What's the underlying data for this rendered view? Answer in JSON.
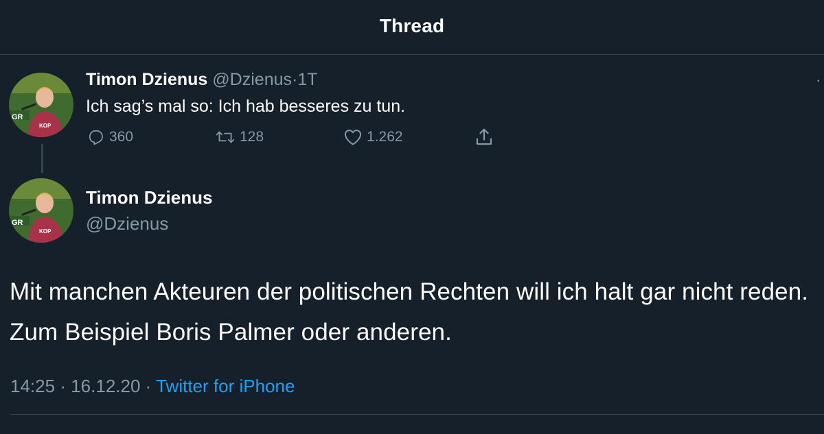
{
  "header": {
    "title": "Thread"
  },
  "tweet1": {
    "name": "Timon Dzienus",
    "handle": "@Dzienus",
    "separator": "·",
    "time": "1T",
    "text": "Ich sag’s mal so: Ich hab besseres zu tun.",
    "actions": {
      "replies": "360",
      "retweets": "128",
      "likes": "1.262"
    },
    "icons": [
      "reply-icon",
      "retweet-icon",
      "like-icon",
      "share-icon",
      "more-icon"
    ]
  },
  "tweet2": {
    "name": "Timon Dzienus",
    "handle": "@Dzienus",
    "text": "Mit manchen Akteuren der politischen Rechten will ich halt gar nicht reden. Zum Beispiel Boris Palmer oder anderen.",
    "time": "14:25",
    "separator": "·",
    "date": "16.12.20",
    "source": "Twitter for iPhone"
  },
  "colors": {
    "background": "#15202b",
    "divider": "#38444d",
    "secondary_text": "#8899a6",
    "link": "#1da1f2"
  }
}
